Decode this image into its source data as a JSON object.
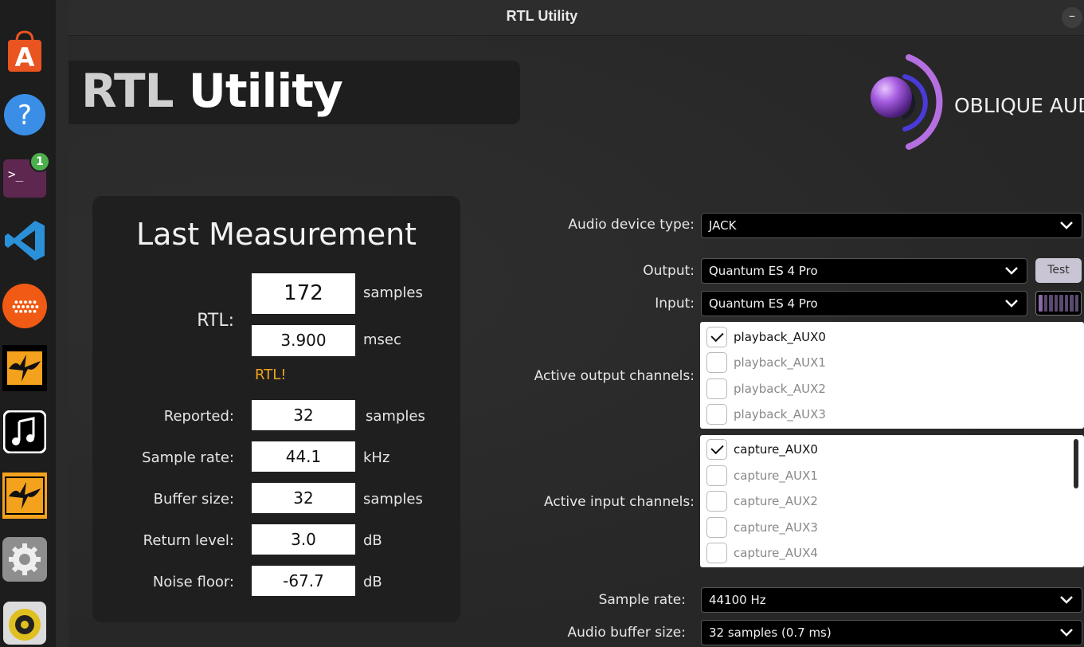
{
  "dock": {
    "items": [
      {
        "name": "app-center",
        "icon": "shopping-bag-icon",
        "color": "#e95420"
      },
      {
        "name": "help",
        "icon": "help-icon",
        "color": "#3a8ee6"
      },
      {
        "name": "terminal",
        "icon": "terminal-icon",
        "color": "#5e2750",
        "badge": "1"
      },
      {
        "name": "vscode",
        "icon": "vscode-icon",
        "color": "#2a90d8"
      },
      {
        "name": "audio-app",
        "icon": "dots-grid-icon",
        "color": "#f05a14"
      },
      {
        "name": "reaper-1",
        "icon": "lightning-icon",
        "color": "#f4a21d"
      },
      {
        "name": "music",
        "icon": "music-note-icon",
        "color": "#ffffff"
      },
      {
        "name": "reaper-2",
        "icon": "lightning-icon",
        "color": "#f4a21d"
      },
      {
        "name": "settings",
        "icon": "gear-icon",
        "color": "#bbbbbb"
      },
      {
        "name": "speaker",
        "icon": "speaker-icon",
        "color": "#e0c020"
      }
    ]
  },
  "window": {
    "title": "RTL Utility",
    "minimize": "–"
  },
  "banner": {
    "rtl": "RTL",
    "utility": "Utility"
  },
  "logo": {
    "text": "OBLIQUE AUD",
    "accent": "#b66fe0"
  },
  "measurement": {
    "title": "Last Measurement",
    "rtl_label": "RTL:",
    "rtl_samples": "172",
    "rtl_samples_unit": "samples",
    "rtl_msec": "3.900",
    "rtl_msec_unit": "msec",
    "rtl_flag": "RTL!",
    "rows": [
      {
        "label": "Reported:",
        "value": "32",
        "unit": "samples"
      },
      {
        "label": "Sample rate:",
        "value": "44.1",
        "unit": "kHz"
      },
      {
        "label": "Buffer size:",
        "value": "32",
        "unit": "samples"
      },
      {
        "label": "Return level:",
        "value": "3.0",
        "unit": "dB"
      },
      {
        "label": "Noise floor:",
        "value": "-67.7",
        "unit": "dB"
      }
    ]
  },
  "settings": {
    "device_type_label": "Audio device type:",
    "device_type_value": "JACK",
    "output_label": "Output:",
    "output_value": "Quantum ES 4 Pro",
    "test_label": "Test",
    "input_label": "Input:",
    "input_value": "Quantum ES 4 Pro",
    "active_output_label": "Active output channels:",
    "output_channels": [
      {
        "name": "playback_AUX0",
        "checked": true
      },
      {
        "name": "playback_AUX1",
        "checked": false
      },
      {
        "name": "playback_AUX2",
        "checked": false
      },
      {
        "name": "playback_AUX3",
        "checked": false
      }
    ],
    "active_input_label": "Active input channels:",
    "input_channels": [
      {
        "name": "capture_AUX0",
        "checked": true
      },
      {
        "name": "capture_AUX1",
        "checked": false
      },
      {
        "name": "capture_AUX2",
        "checked": false
      },
      {
        "name": "capture_AUX3",
        "checked": false
      },
      {
        "name": "capture_AUX4",
        "checked": false
      }
    ],
    "sample_rate_label": "Sample rate:",
    "sample_rate_value": "44100 Hz",
    "buffer_label": "Audio buffer size:",
    "buffer_value": "32 samples (0.7 ms)"
  }
}
